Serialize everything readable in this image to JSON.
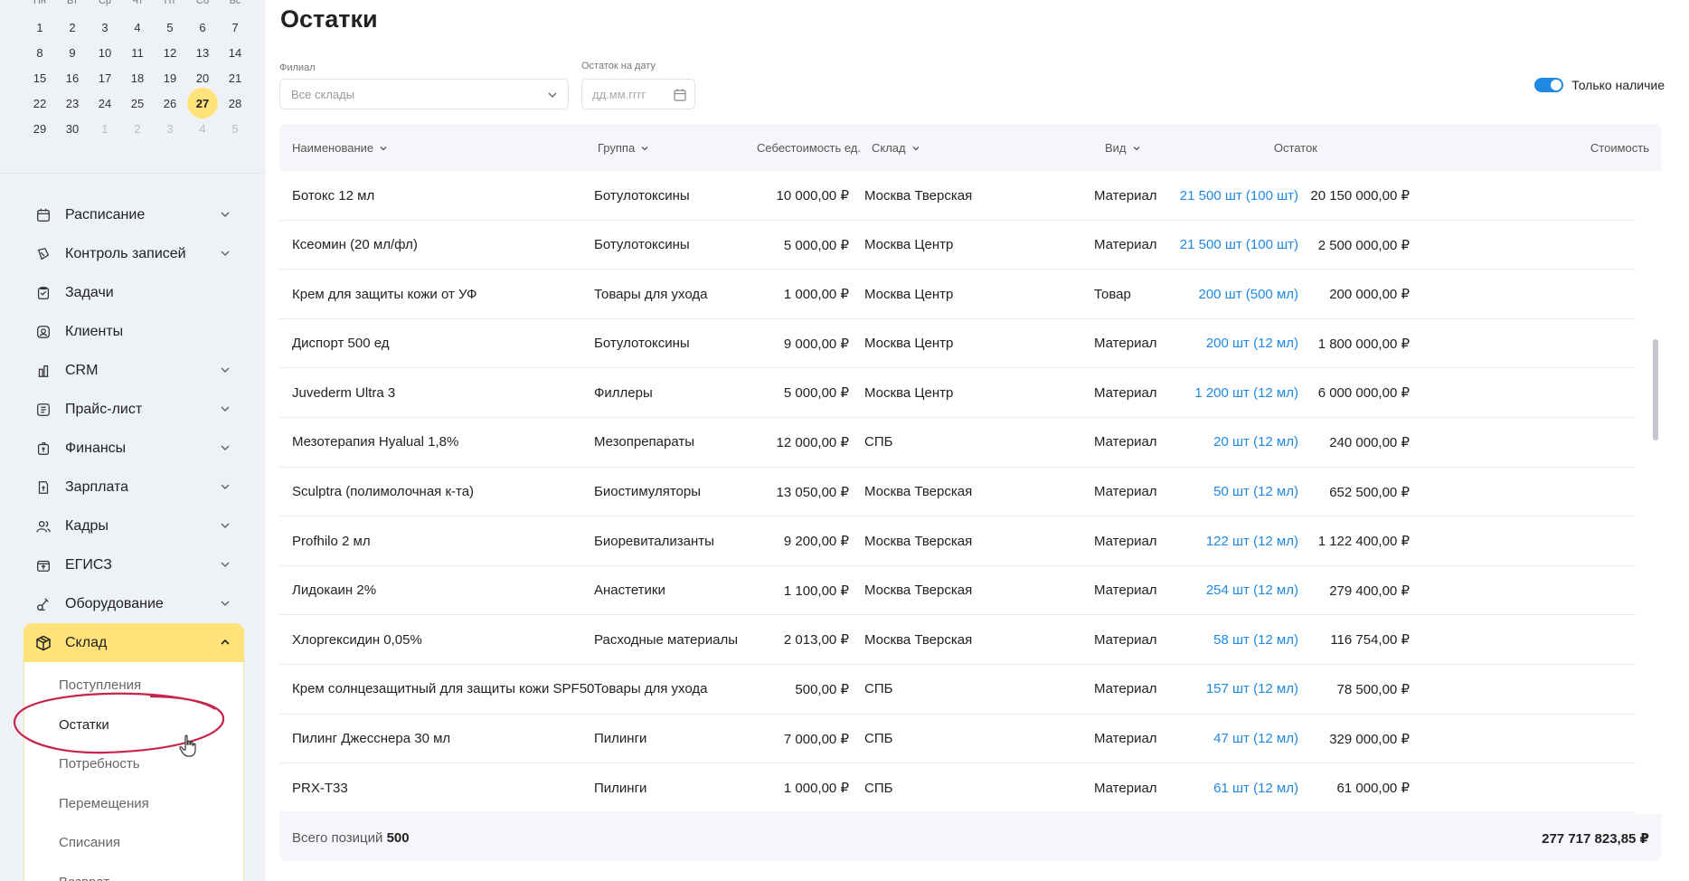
{
  "calendar": {
    "weekdays": [
      "Пн",
      "Вт",
      "Ср",
      "Чт",
      "Пт",
      "Сб",
      "Вс"
    ],
    "weeks": [
      [
        "1",
        "2",
        "3",
        "4",
        "5",
        "6",
        "7"
      ],
      [
        "8",
        "9",
        "10",
        "11",
        "12",
        "13",
        "14"
      ],
      [
        "15",
        "16",
        "17",
        "18",
        "19",
        "20",
        "21"
      ],
      [
        "22",
        "23",
        "24",
        "25",
        "26",
        "27",
        "28"
      ],
      [
        "29",
        "30",
        "1",
        "2",
        "3",
        "4",
        "5"
      ]
    ],
    "today": "27"
  },
  "nav": {
    "items": [
      {
        "label": "Расписание",
        "icon": "calendar-icon",
        "expandable": true
      },
      {
        "label": "Контроль записей",
        "icon": "records-control-icon",
        "expandable": true
      },
      {
        "label": "Задачи",
        "icon": "tasks-icon",
        "expandable": false
      },
      {
        "label": "Клиенты",
        "icon": "clients-icon",
        "expandable": false
      },
      {
        "label": "CRM",
        "icon": "crm-icon",
        "expandable": true
      },
      {
        "label": "Прайс-лист",
        "icon": "price-list-icon",
        "expandable": true
      },
      {
        "label": "Финансы",
        "icon": "finance-icon",
        "expandable": true
      },
      {
        "label": "Зарплата",
        "icon": "salary-icon",
        "expandable": true
      },
      {
        "label": "Кадры",
        "icon": "staff-icon",
        "expandable": true
      },
      {
        "label": "ЕГИСЗ",
        "icon": "egisz-icon",
        "expandable": true
      },
      {
        "label": "Оборудование",
        "icon": "equipment-icon",
        "expandable": true
      }
    ],
    "active": {
      "label": "Склад",
      "icon": "box-icon"
    },
    "subitems": [
      "Поступления",
      "Остатки",
      "Потребность",
      "Перемещения",
      "Списания",
      "Возврат"
    ],
    "current_subitem": "Остатки"
  },
  "page": {
    "title": "Остатки",
    "filters": {
      "branch_label": "Филиал",
      "branch_value": "Все склады",
      "date_label": "Остаток на дату",
      "date_placeholder": "дд.мм.гггг",
      "only_available_label": "Только наличие",
      "only_available": true
    }
  },
  "table": {
    "columns": {
      "name": "Наименование",
      "group": "Группа",
      "unit_cost": "Себестоимость ед.",
      "warehouse": "Склад",
      "type": "Вид",
      "stock": "Остаток",
      "value": "Стоимость"
    },
    "rows": [
      {
        "name": "Ботокс 12 мл",
        "group": "Ботулотоксины",
        "unit_cost": "10 000,00 ₽",
        "warehouse": "Москва Тверская",
        "type": "Материал",
        "stock": "21 500 шт (100 шт)",
        "value": "20 150 000,00 ₽"
      },
      {
        "name": "Ксеомин (20 мл/фл)",
        "group": "Ботулотоксины",
        "unit_cost": "5 000,00 ₽",
        "warehouse": "Москва Центр",
        "type": "Материал",
        "stock": "21 500 шт (100 шт)",
        "value": "2 500 000,00 ₽"
      },
      {
        "name": "Крем для защиты кожи от УФ",
        "group": "Товары для ухода",
        "unit_cost": "1 000,00 ₽",
        "warehouse": "Москва Центр",
        "type": "Товар",
        "stock": "200 шт (500 мл)",
        "value": "200 000,00 ₽"
      },
      {
        "name": "Диспорт 500 ед",
        "group": "Ботулотоксины",
        "unit_cost": "9 000,00 ₽",
        "warehouse": "Москва Центр",
        "type": "Материал",
        "stock": "200 шт (12 мл)",
        "value": "1 800 000,00 ₽"
      },
      {
        "name": "Juvederm Ultra 3",
        "group": "Филлеры",
        "unit_cost": "5 000,00 ₽",
        "warehouse": "Москва Центр",
        "type": "Материал",
        "stock": "1 200 шт (12 мл)",
        "value": "6 000 000,00 ₽"
      },
      {
        "name": "Мезотерапия Hyalual 1,8%",
        "group": "Мезопрепараты",
        "unit_cost": "12 000,00 ₽",
        "warehouse": "СПБ",
        "type": "Материал",
        "stock": "20 шт (12 мл)",
        "value": "240 000,00 ₽"
      },
      {
        "name": "Sculptra (полимолочная к-та)",
        "group": "Биостимуляторы",
        "unit_cost": "13 050,00 ₽",
        "warehouse": "Москва Тверская",
        "type": "Материал",
        "stock": "50 шт (12 мл)",
        "value": "652 500,00 ₽"
      },
      {
        "name": "Profhilo 2 мл",
        "group": "Биоревитализанты",
        "unit_cost": "9 200,00 ₽",
        "warehouse": "Москва Тверская",
        "type": "Материал",
        "stock": "122 шт (12 мл)",
        "value": "1 122 400,00 ₽"
      },
      {
        "name": "Лидокаин 2%",
        "group": "Анастетики",
        "unit_cost": "1 100,00 ₽",
        "warehouse": "Москва Тверская",
        "type": "Материал",
        "stock": "254 шт (12 мл)",
        "value": "279 400,00 ₽"
      },
      {
        "name": "Хлоргексидин 0,05%",
        "group": "Расходные материалы",
        "unit_cost": "2 013,00 ₽",
        "warehouse": "Москва Тверская",
        "type": "Материал",
        "stock": "58 шт (12 мл)",
        "value": "116 754,00 ₽"
      },
      {
        "name": "Крем солнцезащитный для защиты кожи SPF50",
        "group": "Товары для ухода",
        "unit_cost": "500,00 ₽",
        "warehouse": "СПБ",
        "type": "Материал",
        "stock": "157 шт (12 мл)",
        "value": "78 500,00 ₽"
      },
      {
        "name": "Пилинг Джесснера 30 мл",
        "group": "Пилинги",
        "unit_cost": "7 000,00 ₽",
        "warehouse": "СПБ",
        "type": "Материал",
        "stock": "47 шт (12 мл)",
        "value": "329 000,00 ₽"
      },
      {
        "name": "PRX-T33",
        "group": "Пилинги",
        "unit_cost": "1 000,00 ₽",
        "warehouse": "СПБ",
        "type": "Материал",
        "stock": "61 шт (12 мл)",
        "value": "61 000,00 ₽"
      }
    ],
    "footer": {
      "total_label": "Всего позиций",
      "total_count": "500",
      "total_sum": "277 717 823,85 ₽"
    }
  },
  "colors": {
    "accent": "#1e88e5",
    "active_nav": "#ffe27a",
    "highlight_ellipse": "#c8234a",
    "sidebar_bg": "#eef2f7"
  }
}
